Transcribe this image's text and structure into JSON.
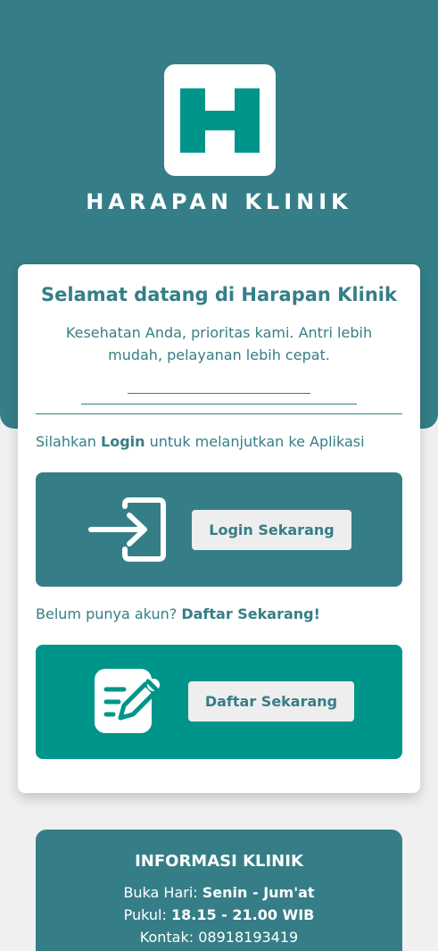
{
  "brand": {
    "logo_letter": "H",
    "name": "HARAPAN KLINIK"
  },
  "welcome_card": {
    "title": "Selamat datang di Harapan Klinik",
    "tagline": "Kesehatan Anda, prioritas kami. Antri lebih mudah, pelayanan lebih cepat.",
    "login_prompt": {
      "before": "Silahkan",
      "emphasis": "Login",
      "after": "untuk melanjutkan ke Aplikasi"
    },
    "login_button": "Login Sekarang",
    "register_prompt": {
      "before": "Belum punya akun?",
      "emphasis": "Daftar Sekarang!"
    },
    "register_button": "Daftar Sekarang"
  },
  "clinic_info": {
    "title": "INFORMASI KLINIK",
    "days_label": "Buka Hari:",
    "days_value": "Senin - Jum'at",
    "hours_label": "Pukul:",
    "hours_value": "18.15 - 21.00 WIB",
    "contact_label": "Kontak:",
    "contact_value": "08918193419"
  },
  "colors": {
    "primary": "#357e87",
    "accent": "#00958a",
    "background": "#f0f0f0",
    "button_bg": "#eeeeee"
  },
  "icons": {
    "logo": "hospital-h-logo",
    "login": "login-arrow-icon",
    "register": "edit-document-icon"
  }
}
